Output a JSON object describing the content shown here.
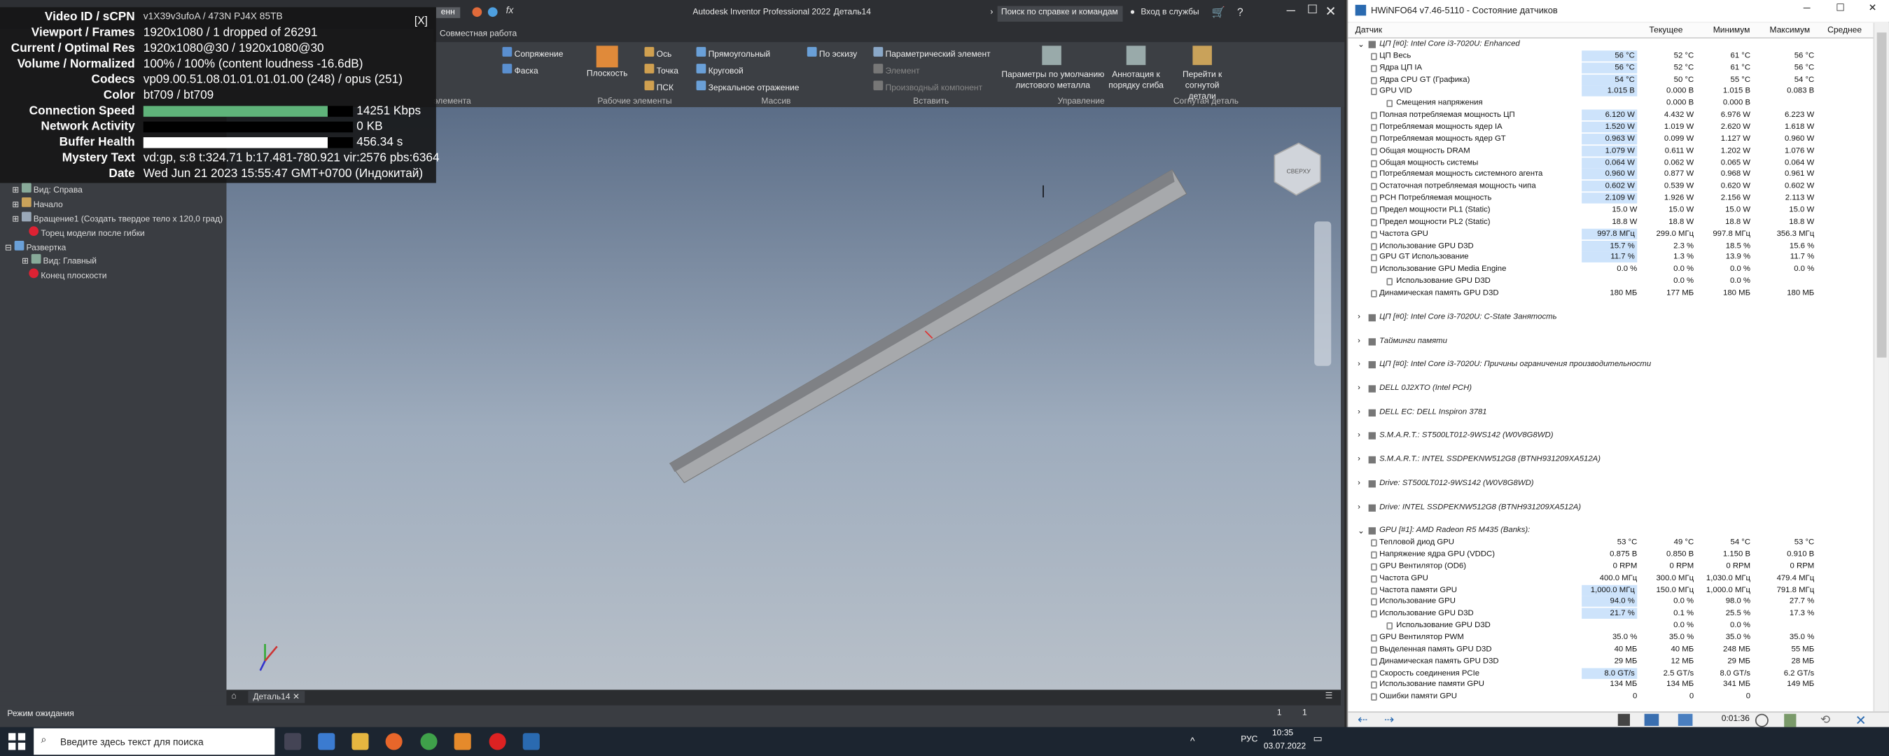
{
  "stats": {
    "close": "[X]",
    "rows": [
      {
        "label": "Video ID / sCPN",
        "value": "v1X39v3ufoA / 473N PJ4X 85TB"
      },
      {
        "label": "Viewport / Frames",
        "value": "1920x1080 / 1 dropped of 26291"
      },
      {
        "label": "Current / Optimal Res",
        "value": "1920x1080@30 / 1920x1080@30"
      },
      {
        "label": "Volume / Normalized",
        "value": "100% / 100% (content loudness -16.6dB)"
      },
      {
        "label": "Codecs",
        "value": "vp09.00.51.08.01.01.01.01.00 (248) / opus (251)"
      },
      {
        "label": "Color",
        "value": "bt709 / bt709"
      },
      {
        "label": "Connection Speed",
        "value": "14251 Kbps"
      },
      {
        "label": "Network Activity",
        "value": "0 KB"
      },
      {
        "label": "Buffer Health",
        "value": "456.34 s"
      },
      {
        "label": "Mystery Text",
        "value": "vd:gp, s:8 t:324.71 b:17.481-780.921 vir:2576 pbs:6364"
      },
      {
        "label": "Date",
        "value": "Wed Jun 21 2023 15:55:47 GMT+0700 (Индокитай)"
      }
    ],
    "connection_fill": 0.88,
    "network_fill": 0.0,
    "buffer_fill": 0.88,
    "connection_color": "#5fb37a",
    "buffer_color": "#ffffff"
  },
  "inventor": {
    "title": "Autodesk Inventor Professional 2022",
    "doc": "Деталь14",
    "search": "Поиск по справке и командам",
    "login": "Вход в службы",
    "ribbon_tab": "Совместная работа",
    "combo": "енн",
    "buttons": {
      "sopryazh": "Сопряжение",
      "faska": "Фаска",
      "ploskost": "Плоскость",
      "os": "Ось",
      "tochka": "Точка",
      "psk": "ПСК",
      "pryam": "Прямоугольный",
      "krug": "Круговой",
      "zerk": "Зеркальное отражение",
      "po_eskizu": "По эскизу",
      "param": "Параметрический элемент",
      "element": "Элемент",
      "proizv": "Производный компонент",
      "defaults": "Параметры по умолчанию листового металла",
      "annot": "Аннотация к порядку сгиба",
      "goto": "Перейти к согнутой детали"
    },
    "groups": {
      "rab": "Рабочие элементы",
      "massiv": "Массив",
      "vstavit": "Вставить",
      "uprav": "Управление",
      "sogn": "Согнутая деталь",
      "elem": "элемента"
    },
    "browser": [
      "Вид: Справа",
      "Начало",
      "Вращение1 (Создать твердое тело x 120,0 град)",
      "Торец модели после гибки",
      "Развертка",
      "Вид: Главный",
      "Конец плоскости"
    ],
    "tab_doc": "Деталь14",
    "status": "Режим ожидания",
    "status_nums": [
      "1",
      "1"
    ],
    "cube_label": "СВЕРХУ"
  },
  "hw": {
    "title": "HWiNFO64 v7.46-5110 - Состояние датчиков",
    "cols": [
      "Датчик",
      "Текущее",
      "Минимум",
      "Максимум",
      "Среднее"
    ],
    "time": "0:01:36",
    "rows": [
      {
        "t": "g",
        "n": "ЦП [#0]: Intel Core i3-7020U: Enhanced",
        "x": true
      },
      {
        "n": "ЦП Весь",
        "v": [
          "56 °C",
          "52 °C",
          "61 °C",
          "56 °C"
        ],
        "h": true
      },
      {
        "n": "Ядра ЦП IA",
        "v": [
          "56 °C",
          "52 °C",
          "61 °C",
          "56 °C"
        ],
        "h": true
      },
      {
        "n": "Ядра CPU GT (Графика)",
        "v": [
          "54 °C",
          "50 °C",
          "55 °C",
          "54 °C"
        ],
        "h": true
      },
      {
        "n": "GPU VID",
        "v": [
          "1.015 В",
          "0.000 В",
          "1.015 В",
          "0.083 В"
        ],
        "h": true
      },
      {
        "n": "Смещения напряжения",
        "v": [
          "",
          "0.000 В",
          "0.000 В",
          ""
        ],
        "sub": true
      },
      {
        "n": "Полная потребляемая мощность ЦП",
        "v": [
          "6.120 W",
          "4.432 W",
          "6.976 W",
          "6.223 W"
        ],
        "h": true
      },
      {
        "n": "Потребляемая мощность ядер IA",
        "v": [
          "1.520 W",
          "1.019 W",
          "2.620 W",
          "1.618 W"
        ],
        "h": true
      },
      {
        "n": "Потребляемая мощность ядер GT",
        "v": [
          "0.963 W",
          "0.099 W",
          "1.127 W",
          "0.960 W"
        ],
        "h": true
      },
      {
        "n": "Общая мощность DRAM",
        "v": [
          "1.079 W",
          "0.611 W",
          "1.202 W",
          "1.076 W"
        ],
        "h": true
      },
      {
        "n": "Общая мощность системы",
        "v": [
          "0.064 W",
          "0.062 W",
          "0.065 W",
          "0.064 W"
        ],
        "h": true
      },
      {
        "n": "Потребляемая мощность системного агента",
        "v": [
          "0.960 W",
          "0.877 W",
          "0.968 W",
          "0.961 W"
        ],
        "h": true
      },
      {
        "n": "Остаточная потребляемая мощность чипа",
        "v": [
          "0.602 W",
          "0.539 W",
          "0.620 W",
          "0.602 W"
        ],
        "h": true
      },
      {
        "n": "PCH Потребляемая мощность",
        "v": [
          "2.109 W",
          "1.926 W",
          "2.156 W",
          "2.113 W"
        ],
        "h": true
      },
      {
        "n": "Предел мощности PL1 (Static)",
        "v": [
          "15.0 W",
          "15.0 W",
          "15.0 W",
          "15.0 W"
        ]
      },
      {
        "n": "Предел мощности PL2 (Static)",
        "v": [
          "18.8 W",
          "18.8 W",
          "18.8 W",
          "18.8 W"
        ]
      },
      {
        "n": "Частота GPU",
        "v": [
          "997.8 МГц",
          "299.0 МГц",
          "997.8 МГц",
          "356.3 МГц"
        ],
        "h": true
      },
      {
        "n": "Использование GPU D3D",
        "v": [
          "15.7 %",
          "2.3 %",
          "18.5 %",
          "15.6 %"
        ],
        "h": true
      },
      {
        "n": "GPU GT Использование",
        "v": [
          "11.7 %",
          "1.3 %",
          "13.9 %",
          "11.7 %"
        ],
        "h": true
      },
      {
        "n": "Использование GPU Media Engine",
        "v": [
          "0.0 %",
          "0.0 %",
          "0.0 %",
          "0.0 %"
        ]
      },
      {
        "n": "Использование GPU D3D",
        "v": [
          "",
          "0.0 %",
          "0.0 %",
          ""
        ],
        "sub": true
      },
      {
        "n": "Динамическая память GPU D3D",
        "v": [
          "180 МБ",
          "177 МБ",
          "180 МБ",
          "180 МБ"
        ]
      },
      {
        "t": "e"
      },
      {
        "t": "g",
        "n": "ЦП [#0]: Intel Core i3-7020U: C-State Занятость"
      },
      {
        "t": "e"
      },
      {
        "t": "g",
        "n": "Тайминги памяти"
      },
      {
        "t": "e"
      },
      {
        "t": "g",
        "n": "ЦП [#0]: Intel Core i3-7020U: Причины ограничения производительности"
      },
      {
        "t": "e"
      },
      {
        "t": "g",
        "n": "DELL 0J2XTO (Intel PCH)"
      },
      {
        "t": "e"
      },
      {
        "t": "g",
        "n": "DELL EC: DELL Inspiron 3781"
      },
      {
        "t": "e"
      },
      {
        "t": "g",
        "n": "S.M.A.R.T.: ST500LT012-9WS142 (W0V8G8WD)"
      },
      {
        "t": "e"
      },
      {
        "t": "g",
        "n": "S.M.A.R.T.: INTEL SSDPEKNW512G8 (BTNH931209XA512A)"
      },
      {
        "t": "e"
      },
      {
        "t": "g",
        "n": "Drive: ST500LT012-9WS142 (W0V8G8WD)"
      },
      {
        "t": "e"
      },
      {
        "t": "g",
        "n": "Drive: INTEL SSDPEKNW512G8 (BTNH931209XA512A)"
      },
      {
        "t": "e"
      },
      {
        "t": "g",
        "n": "GPU [#1]: AMD Radeon R5 M435 (Banks):",
        "x": true
      },
      {
        "n": "Тепловой диод GPU",
        "v": [
          "53 °C",
          "49 °C",
          "54 °C",
          "53 °C"
        ]
      },
      {
        "n": "Напряжение ядра GPU (VDDC)",
        "v": [
          "0.875 В",
          "0.850 В",
          "1.150 В",
          "0.910 В"
        ]
      },
      {
        "n": "GPU Вентилятор (OD6)",
        "v": [
          "0 RPM",
          "0 RPM",
          "0 RPM",
          "0 RPM"
        ]
      },
      {
        "n": "Частота GPU",
        "v": [
          "400.0 МГц",
          "300.0 МГц",
          "1,030.0 МГц",
          "479.4 МГц"
        ]
      },
      {
        "n": "Частота памяти GPU",
        "v": [
          "1,000.0 МГц",
          "150.0 МГц",
          "1,000.0 МГц",
          "791.8 МГц"
        ],
        "h": true
      },
      {
        "n": "Использование GPU",
        "v": [
          "94.0 %",
          "0.0 %",
          "98.0 %",
          "27.7 %"
        ],
        "h": true
      },
      {
        "n": "Использование GPU D3D",
        "v": [
          "21.7 %",
          "0.1 %",
          "25.5 %",
          "17.3 %"
        ],
        "h": true
      },
      {
        "n": "Использование GPU D3D",
        "v": [
          "",
          "0.0 %",
          "0.0 %",
          ""
        ],
        "sub": true
      },
      {
        "n": "GPU Вентилятор PWM",
        "v": [
          "35.0 %",
          "35.0 %",
          "35.0 %",
          "35.0 %"
        ]
      },
      {
        "n": "Выделенная память GPU D3D",
        "v": [
          "40 МБ",
          "40 МБ",
          "248 МБ",
          "55 МБ"
        ]
      },
      {
        "n": "Динамическая память GPU D3D",
        "v": [
          "29 МБ",
          "12 МБ",
          "29 МБ",
          "28 МБ"
        ]
      },
      {
        "n": "Скорость соединения PCIe",
        "v": [
          "8.0 GT/s",
          "2.5 GT/s",
          "8.0 GT/s",
          "6.2 GT/s"
        ],
        "h": true
      },
      {
        "n": "Использование памяти GPU",
        "v": [
          "134 МБ",
          "134 МБ",
          "341 МБ",
          "149 МБ"
        ]
      },
      {
        "n": "Ошибки памяти GPU",
        "v": [
          "0",
          "0",
          "0",
          ""
        ]
      }
    ]
  },
  "taskbar": {
    "search": "Введите здесь текст для поиска",
    "time": "10:35",
    "date": "03.07.2022",
    "lang": "РУС"
  }
}
